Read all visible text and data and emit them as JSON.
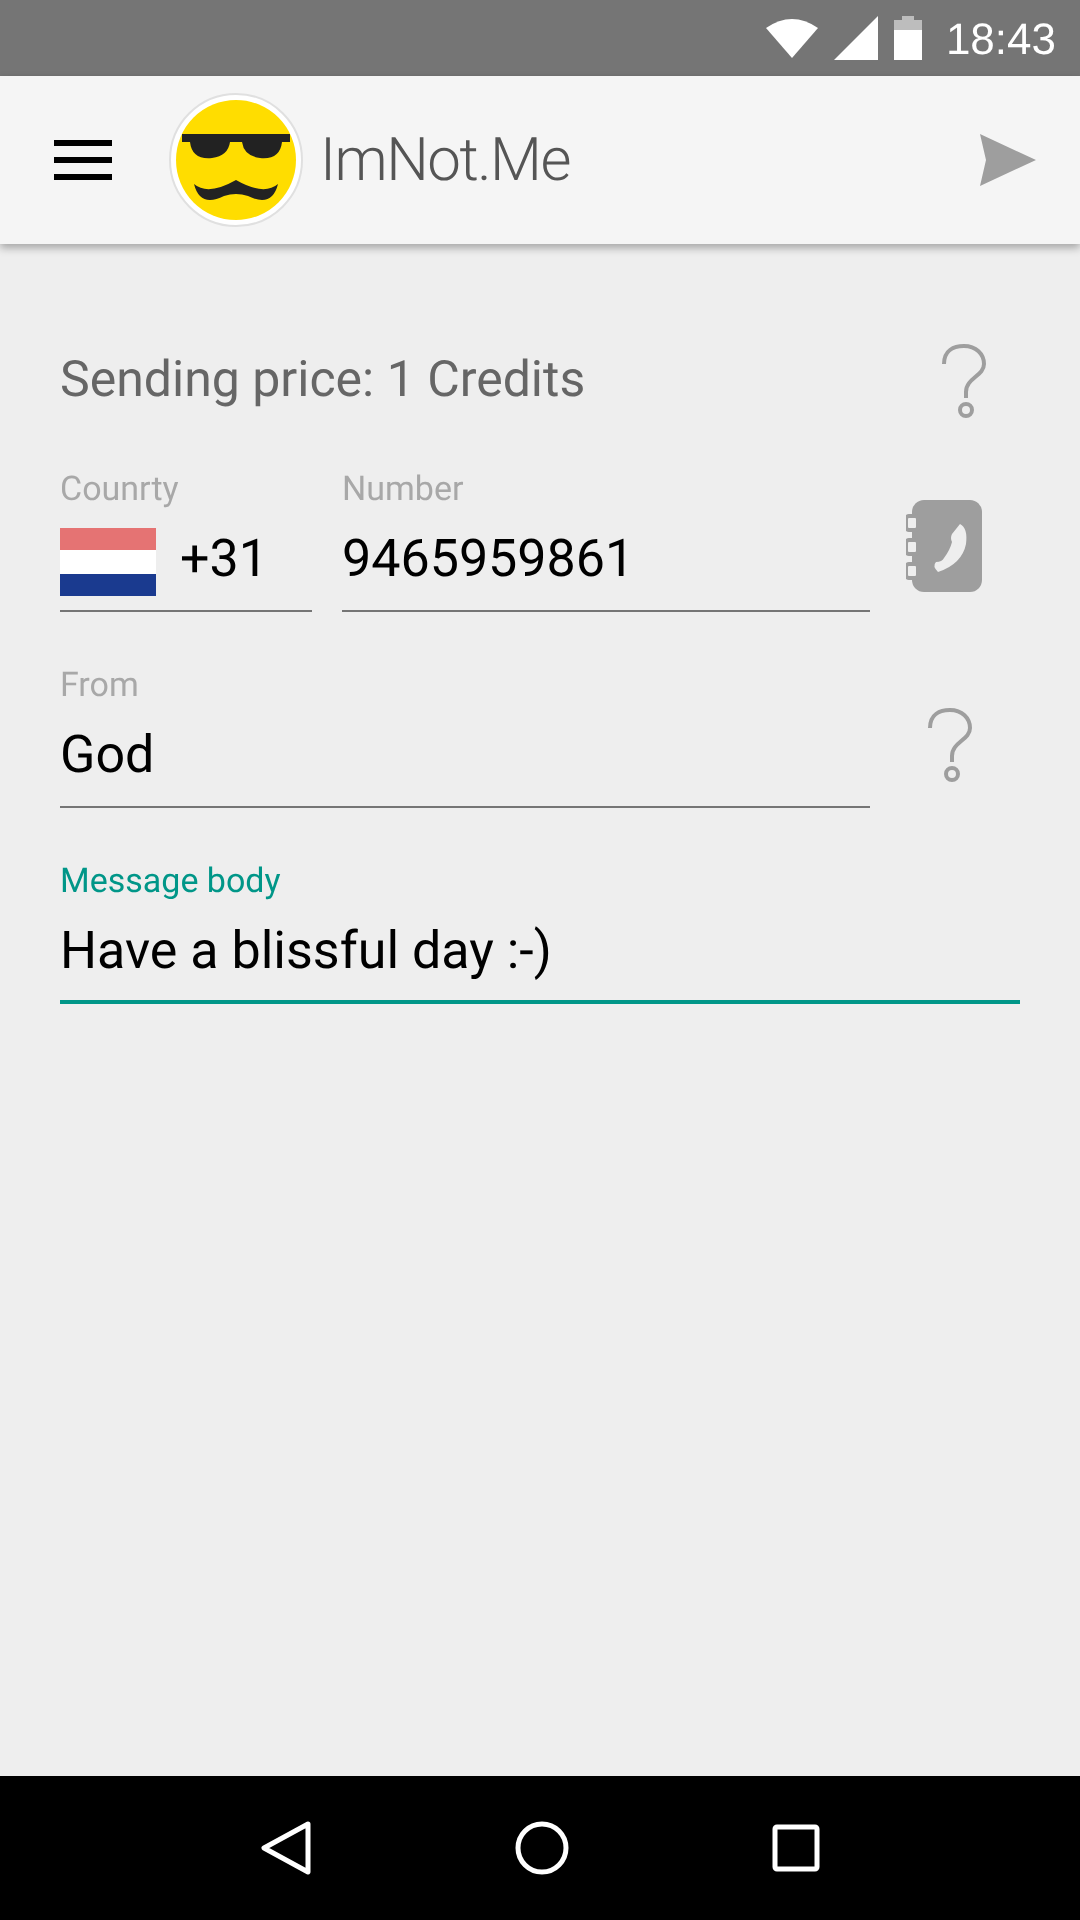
{
  "status_bar": {
    "time": "18:43"
  },
  "app_bar": {
    "title": "ImNot.Me"
  },
  "price": {
    "text": "Sending price: 1 Credits"
  },
  "country": {
    "label": "Counrty",
    "value": "+31",
    "focused": false
  },
  "number": {
    "label": "Number",
    "value": "9465959861",
    "focused": false
  },
  "from": {
    "label": "From",
    "value": "God",
    "focused": false
  },
  "message": {
    "label": "Message body",
    "value": "Have a blissful day :-)",
    "focused": true
  }
}
